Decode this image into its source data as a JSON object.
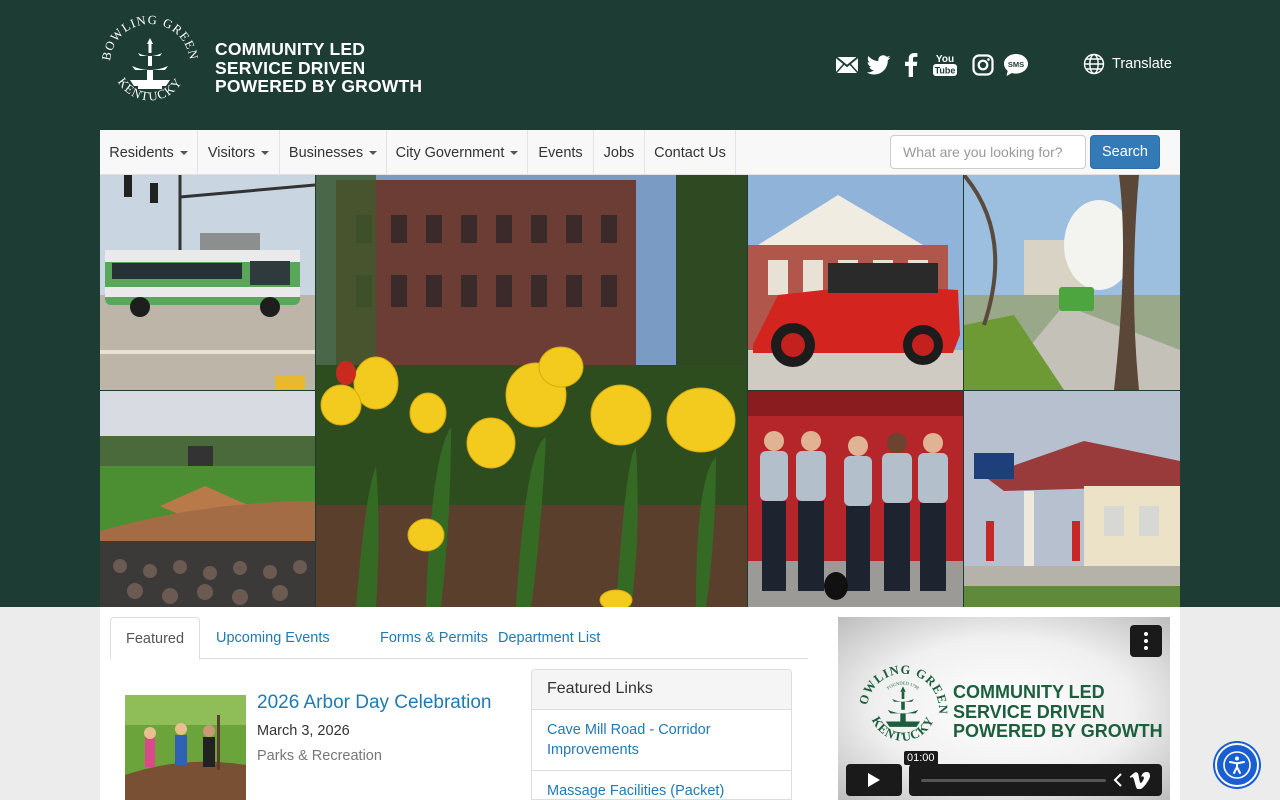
{
  "brand": {
    "seal_text_top": "BOWLING GREEN",
    "seal_text_bottom": "KENTUCKY",
    "tagline": [
      "COMMUNITY LED",
      "SERVICE DRIVEN",
      "POWERED BY GROWTH"
    ]
  },
  "social": {
    "icons": [
      "email-icon",
      "twitter-icon",
      "facebook-icon",
      "youtube-icon",
      "instagram-icon",
      "sms-icon"
    ],
    "youtube_text": [
      "You",
      "Tube"
    ],
    "sms_text": "SMS"
  },
  "translate": {
    "label": "Translate",
    "icon": "globe-icon"
  },
  "nav": {
    "items": [
      {
        "label": "Residents",
        "dropdown": true
      },
      {
        "label": "Visitors",
        "dropdown": true
      },
      {
        "label": "Businesses",
        "dropdown": true
      },
      {
        "label": "City Government",
        "dropdown": true
      },
      {
        "label": "Events",
        "dropdown": false
      },
      {
        "label": "Jobs",
        "dropdown": false
      },
      {
        "label": "Contact Us",
        "dropdown": false
      }
    ],
    "search_placeholder": "What are you looking for?",
    "search_button": "Search"
  },
  "mosaic": {
    "photos": [
      "transit-bus-photo",
      "tulips-downtown-photo",
      "antique-fire-truck-photo",
      "street-trees-photo",
      "baseball-stadium-photo",
      "firefighters-photo",
      "historic-gas-station-photo"
    ]
  },
  "tabs": {
    "items": [
      "Featured",
      "Upcoming Events",
      "Forms & Permits",
      "Department List"
    ],
    "active": "Featured"
  },
  "featured_event": {
    "title": "2026 Arbor Day Celebration",
    "date": "March 3, 2026",
    "department": "Parks & Recreation"
  },
  "featured_links": {
    "heading": "Featured Links",
    "links": [
      "Cave Mill Road - Corridor Improvements",
      "Massage Facilities (Packet)"
    ]
  },
  "video": {
    "seal_text_top": "BOWLING GREEN",
    "seal_text_bottom": "KENTUCKY",
    "seal_text_founded": "FOUNDED 1798",
    "tagline": [
      "COMMUNITY LED",
      "SERVICE DRIVEN",
      "POWERED BY GROWTH"
    ],
    "time_tooltip": "01:00",
    "progress": 0.0
  },
  "colors": {
    "header_bg": "#1d3c33",
    "link": "#1f7ab4",
    "button": "#337ab7",
    "video_green": "#1c5f3d",
    "accessibility": "#1a5fd1"
  }
}
